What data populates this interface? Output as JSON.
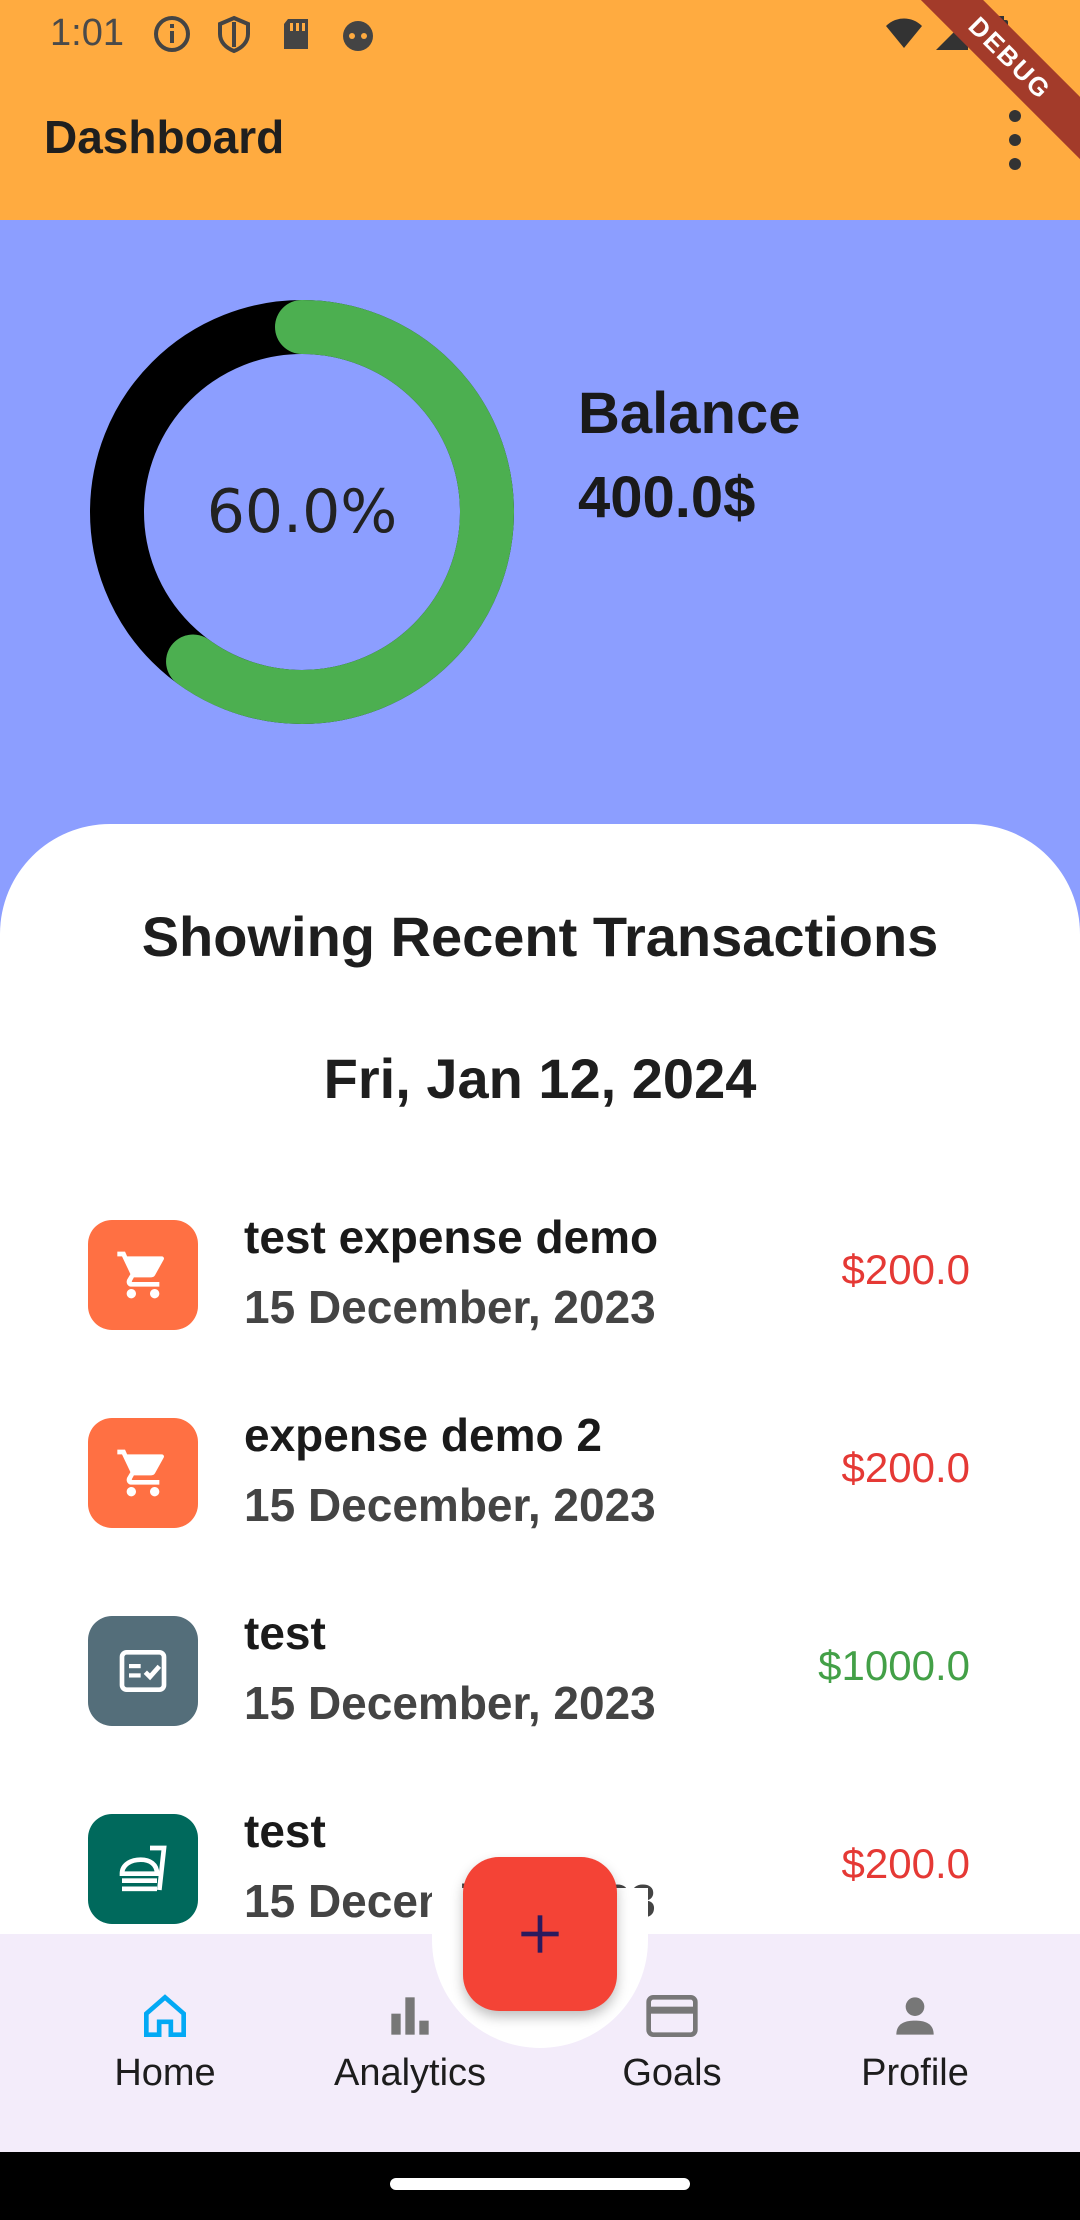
{
  "status_bar": {
    "time": "1:01"
  },
  "app_bar": {
    "title": "Dashboard",
    "ribbon": "DEBUG"
  },
  "summary": {
    "progress_fraction": 0.6,
    "progress_label": "60.0%",
    "balance_label": "Balance",
    "balance_value": "400.0$",
    "colors": {
      "progress": "#4CAF50",
      "track": "#000000",
      "background": "#8C9EFF"
    }
  },
  "transactions": {
    "heading": "Showing Recent Transactions",
    "date": "Fri, Jan 12, 2024",
    "items": [
      {
        "name": "test expense demo",
        "date": "15 December, 2023",
        "amount": "$200.0",
        "amount_color": "#E53935",
        "icon": "cart-icon",
        "icon_bg": "#FF7043"
      },
      {
        "name": "expense demo 2",
        "date": "15 December, 2023",
        "amount": "$200.0",
        "amount_color": "#E53935",
        "icon": "cart-icon",
        "icon_bg": "#FF7043"
      },
      {
        "name": "test",
        "date": "15 December, 2023",
        "amount": "$1000.0",
        "amount_color": "#43A047",
        "icon": "fact-check-icon",
        "icon_bg": "#546E7A"
      },
      {
        "name": "test",
        "date": "15 December, 2023",
        "amount": "$200.0",
        "amount_color": "#E53935",
        "icon": "food-icon",
        "icon_bg": "#00695C"
      }
    ]
  },
  "bottom_nav": {
    "items": [
      {
        "label": "Home",
        "icon": "home-icon"
      },
      {
        "label": "Analytics",
        "icon": "bar-chart-icon"
      },
      {
        "label": "Goals",
        "icon": "card-icon"
      },
      {
        "label": "Profile",
        "icon": "person-icon"
      }
    ],
    "accent_color": "#03A9F4",
    "fab_icon": "plus-icon"
  }
}
